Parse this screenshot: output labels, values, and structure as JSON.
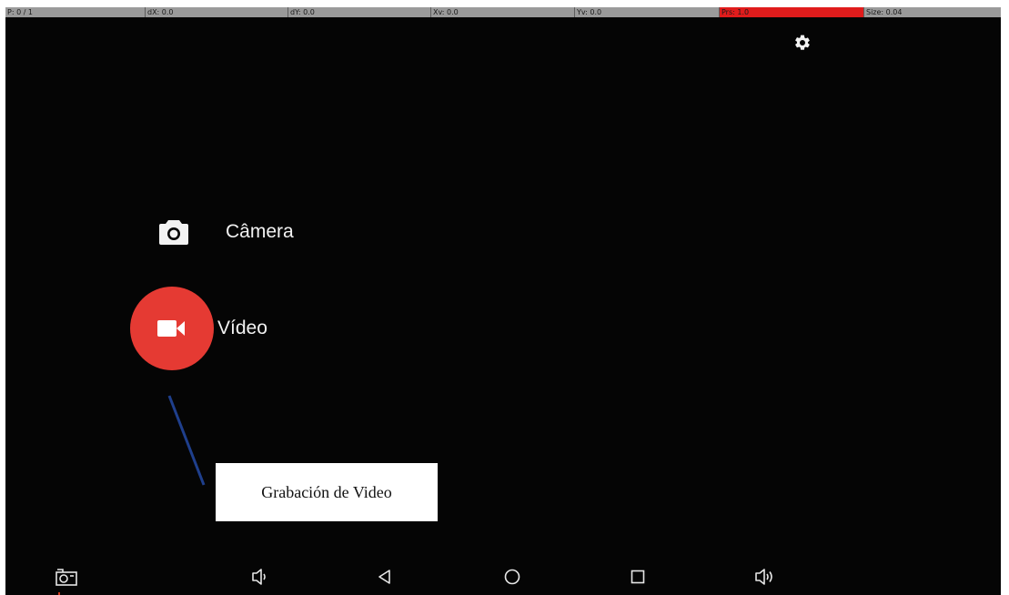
{
  "debug_bar": {
    "pointer": "P: 0 / 1",
    "dx": "dX: 0.0",
    "dy": "dY: 0.0",
    "xv": "Xv: 0.0",
    "yv": "Yv: 0.0",
    "prs": "Prs: 1.0",
    "size": "Size: 0.04"
  },
  "icons": {
    "settings": "gear-icon",
    "camera_mode": "camera-icon",
    "video_mode": "videocam-icon",
    "nav_screenshot": "screenshot-icon",
    "nav_volume_down": "volume-down-icon",
    "nav_back": "back-triangle-icon",
    "nav_home": "home-circle-icon",
    "nav_recents": "recents-square-icon",
    "nav_volume_up": "volume-up-icon"
  },
  "modes": {
    "camera_label": "Câmera",
    "video_label": "Vídeo"
  },
  "annotation": {
    "text": "Grabación de Video"
  },
  "colors": {
    "background": "#050505",
    "video_button": "#e53a33",
    "debug_bar": "#9a9a9a",
    "debug_alert": "#e01c1c",
    "annotation_line": "#1f3f8c"
  }
}
